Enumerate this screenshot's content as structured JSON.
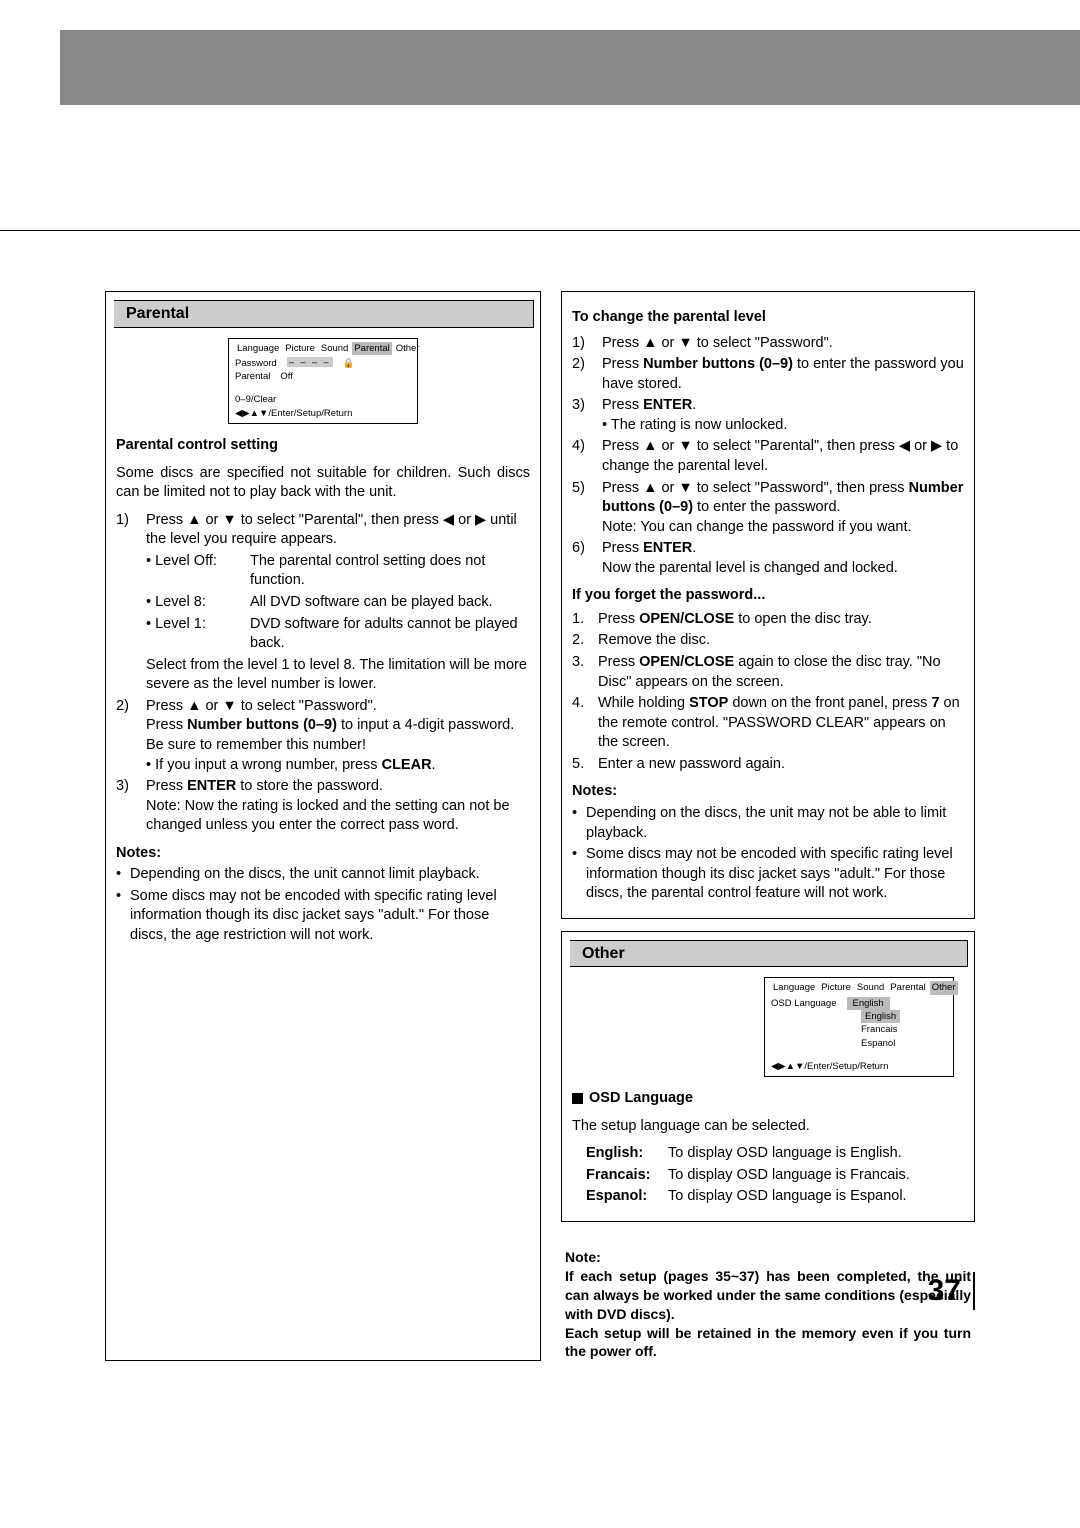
{
  "page_number": "37",
  "left": {
    "section_title": "Parental",
    "osd_shot": {
      "tabs": [
        "Language",
        "Picture",
        "Sound",
        "Parental",
        "Other"
      ],
      "selected_tab": "Parental",
      "row1_label": "Password",
      "row1_value": "– – – –",
      "row2_label": "Parental",
      "row2_value": "Off",
      "hint1": "0–9/Clear",
      "hint2": "◀▶▲▼/Enter/Setup/Return"
    },
    "subhead1": "Parental control setting",
    "intro": "Some discs are specified not suitable for children. Such discs can be limited not to play back with the unit.",
    "steps": {
      "s1a": "Press ▲ or ▼ to select \"Parental\", then press ◀ or ▶ until the level you require appears.",
      "lvl_off_name": "Level Off:",
      "lvl_off_desc": "The parental control setting does not function.",
      "lvl_8_name": "Level 8:",
      "lvl_8_desc": "All DVD software can be played back.",
      "lvl_1_name": "Level 1:",
      "lvl_1_desc": "DVD software for adults cannot be played back.",
      "s1b": "Select from the level 1 to level 8. The limitation will be more severe as the level number is lower.",
      "s2a": "Press ▲ or ▼ to select \"Password\".",
      "s2b_pre": "Press ",
      "s2b_bold": "Number buttons (0–9)",
      "s2b_post": " to input a 4-digit password. Be sure to remember this number!",
      "s2c_pre": "• If you input a wrong number, press ",
      "s2c_bold": "CLEAR",
      "s2c_post": ".",
      "s3a_pre": "Press ",
      "s3a_bold": "ENTER",
      "s3a_post": " to store the password.",
      "s3b": "Note: Now the rating is locked and the setting can not be changed unless you enter the correct pass word."
    },
    "notes_label": "Notes:",
    "notes": [
      "Depending on the discs, the unit cannot limit playback.",
      "Some discs may not be encoded with specific rating level information though its disc jacket says \"adult.\" For those discs, the age restriction will not work."
    ]
  },
  "right_top": {
    "subhead": "To change the parental level",
    "s1": "Press ▲ or ▼ to select \"Password\".",
    "s2_pre": "Press ",
    "s2_bold": "Number buttons (0–9)",
    "s2_post": " to enter the password you have stored.",
    "s3_pre": "Press ",
    "s3_bold": "ENTER",
    "s3_post": ".",
    "s3_sub": "• The rating is now unlocked.",
    "s4": "Press ▲ or ▼ to select \"Parental\", then press ◀ or ▶ to change the parental level.",
    "s5a": "Press ▲ or ▼ to select \"Password\", then press ",
    "s5_bold": "Number buttons (0–9)",
    "s5b": " to enter the password.",
    "s5_note": "Note: You can change the password if you want.",
    "s6_pre": "Press ",
    "s6_bold": "ENTER",
    "s6_post": ".",
    "s6_sub": "Now the parental level is changed and locked.",
    "forgot_head": "If you forget the password...",
    "f1_pre": "Press ",
    "f1_bold": "OPEN/CLOSE",
    "f1_post": " to open the disc tray.",
    "f2": "Remove the disc.",
    "f3_pre": "Press ",
    "f3_bold": "OPEN/CLOSE",
    "f3_post": " again to close the disc tray. \"No Disc\" appears on the screen.",
    "f4_pre": "While holding ",
    "f4_bold1": "STOP",
    "f4_mid": " down on the front panel, press ",
    "f4_bold2": "7",
    "f4_post": " on the remote control. \"PASSWORD CLEAR\" appears on the screen.",
    "f5": "Enter a new password again.",
    "notes_label": "Notes:",
    "notes": [
      "Depending on the discs, the unit may not be able to limit playback.",
      "Some discs may not be encoded with specific rating level information though its disc jacket says \"adult.\" For those discs, the parental control feature will not work."
    ]
  },
  "right_bottom": {
    "section_title": "Other",
    "osd_shot": {
      "tabs": [
        "Language",
        "Picture",
        "Sound",
        "Parental",
        "Other"
      ],
      "selected_tab": "Other",
      "row_label": "OSD Language",
      "row_value": "English",
      "opts": [
        "English",
        "Francais",
        "Espanol"
      ],
      "hint": "◀▶▲▼/Enter/Setup/Return"
    },
    "sub_label": "OSD Language",
    "intro": "The setup language can be selected.",
    "rows": [
      {
        "name": "English:",
        "desc": "To display OSD language is English."
      },
      {
        "name": "Francais:",
        "desc": "To display OSD language is Francais."
      },
      {
        "name": "Espanol:",
        "desc": "To display OSD language is Espanol."
      }
    ]
  },
  "final_note": {
    "label": "Note:",
    "l1": "If each setup (pages 35~37) has been completed, the unit can always be worked under the same conditions (especially with DVD discs).",
    "l2": "Each setup will be retained in the memory even if you turn the power off."
  }
}
